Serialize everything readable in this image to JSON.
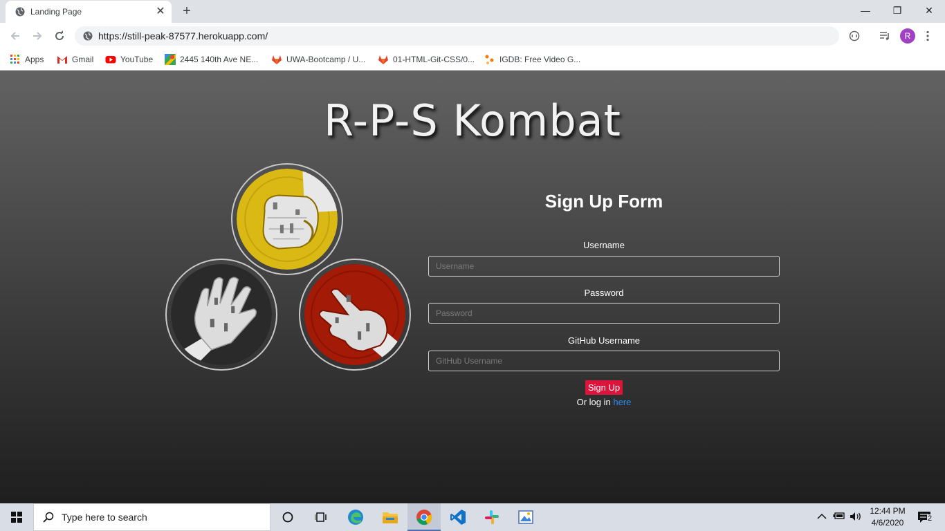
{
  "browser": {
    "tab_title": "Landing Page",
    "tab_close": "✕",
    "new_tab": "+",
    "minimize": "—",
    "restore": "❐",
    "close": "✕",
    "url": "https://still-peak-87577.herokuapp.com/",
    "profile_initial": "R",
    "bookmarks": [
      {
        "label": "Apps",
        "icon": "apps-icon"
      },
      {
        "label": "Gmail",
        "icon": "gmail-icon"
      },
      {
        "label": "YouTube",
        "icon": "youtube-icon"
      },
      {
        "label": "2445 140th Ave NE...",
        "icon": "maps-icon"
      },
      {
        "label": "UWA-Bootcamp / U...",
        "icon": "gitlab-icon"
      },
      {
        "label": "01-HTML-Git-CSS/0...",
        "icon": "gitlab-icon"
      },
      {
        "label": "IGDB: Free Video G...",
        "icon": "igdb-icon"
      }
    ]
  },
  "page": {
    "title": "R-P-S Kombat",
    "form": {
      "heading": "Sign Up Form",
      "username_label": "Username",
      "username_placeholder": "Username",
      "password_label": "Password",
      "password_placeholder": "Password",
      "github_label": "GitHub Username",
      "github_placeholder": "GitHub Username",
      "submit_label": "Sign Up",
      "login_prefix": "Or log in ",
      "login_link": "here"
    },
    "colors": {
      "rock_bg": "#dbb914",
      "paper_bg": "#2a2a2a",
      "scissors_bg": "#a31a06",
      "button": "#dc143c",
      "link": "#2b8cf5"
    }
  },
  "taskbar": {
    "search_placeholder": "Type here to search",
    "time": "12:44 PM",
    "date": "4/6/2020",
    "notifications": "2"
  }
}
